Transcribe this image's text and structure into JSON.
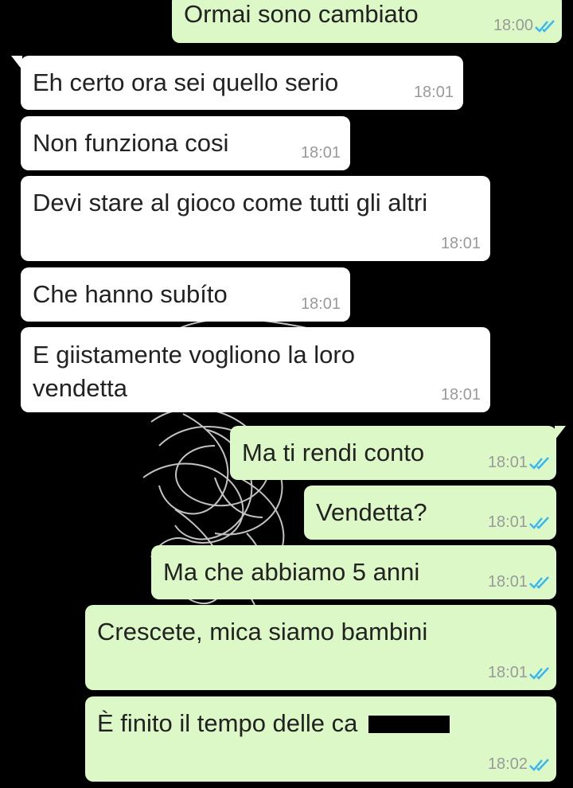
{
  "messages": [
    {
      "dir": "out",
      "text": "Ormai sono cambiato",
      "time": "18:00",
      "ticks": "double-check-icon"
    },
    {
      "dir": "in",
      "text": "Eh certo ora sei quello serio",
      "time": "18:01"
    },
    {
      "dir": "in",
      "text": "Non funziona cosi",
      "time": "18:01"
    },
    {
      "dir": "in",
      "text": "Devi stare al gioco come tutti gli altri",
      "time": "18:01"
    },
    {
      "dir": "in",
      "text": "Che hanno subíto",
      "time": "18:01"
    },
    {
      "dir": "in",
      "text": "E giistamente vogliono la loro\nvendetta",
      "time": "18:01"
    },
    {
      "dir": "out",
      "text": "Ma ti rendi conto",
      "time": "18:01",
      "ticks": "double-check-icon"
    },
    {
      "dir": "out",
      "text": "Vendetta?",
      "time": "18:01",
      "ticks": "double-check-icon"
    },
    {
      "dir": "out",
      "text": "Ma che abbiamo 5 anni",
      "time": "18:01",
      "ticks": "double-check-icon"
    },
    {
      "dir": "out",
      "text": "Crescete, mica siamo bambini",
      "time": "18:01",
      "ticks": "double-check-icon"
    },
    {
      "dir": "out",
      "text": "È finito il tempo delle ca",
      "time": "18:02",
      "ticks": "double-check-icon",
      "redacted": true
    }
  ],
  "colors": {
    "incoming_bubble": "#ffffff",
    "outgoing_bubble": "#dcf8c6",
    "read_ticks": "#34b7f1",
    "background": "#000000"
  }
}
